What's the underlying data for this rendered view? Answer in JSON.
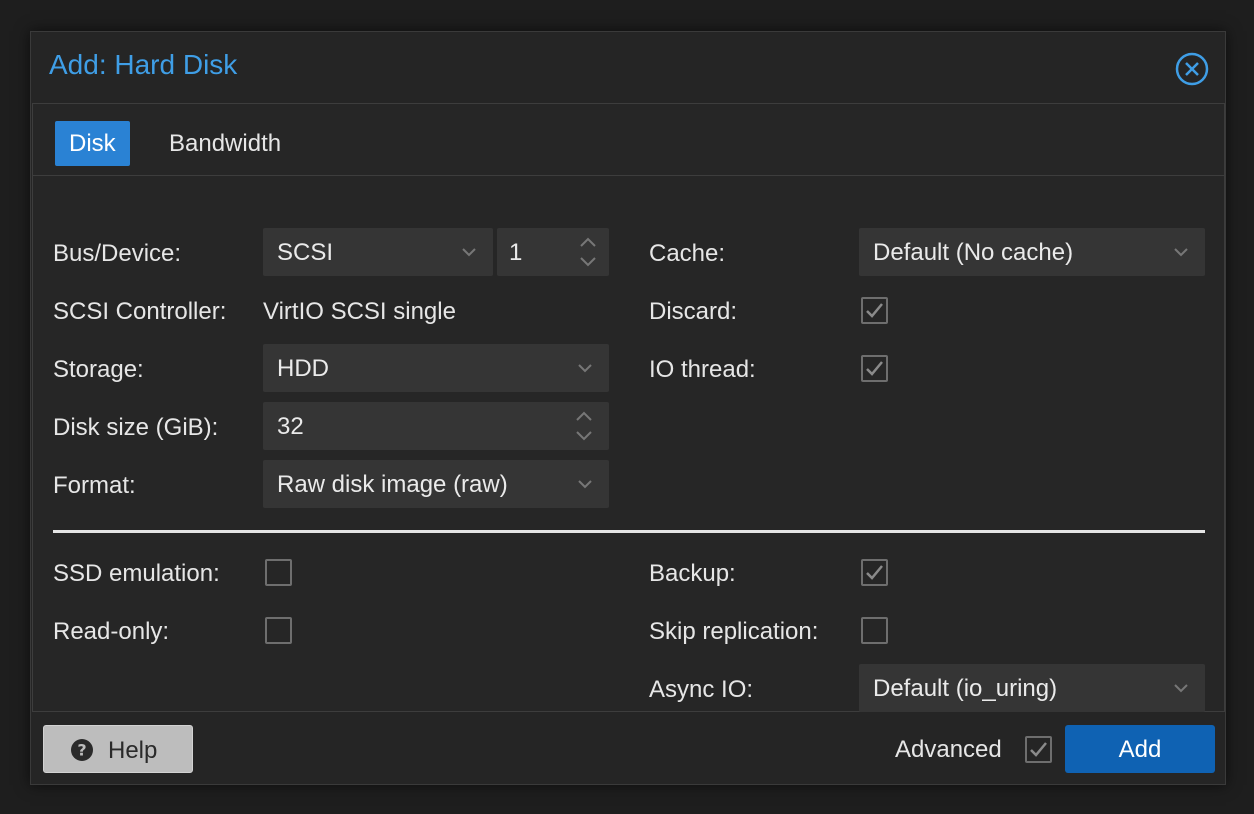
{
  "dialog": {
    "title": "Add: Hard Disk",
    "close_icon": "close-circle-icon"
  },
  "tabs": [
    {
      "label": "Disk",
      "active": true
    },
    {
      "label": "Bandwidth",
      "active": false
    }
  ],
  "left_fields": {
    "bus_device": {
      "label": "Bus/Device:",
      "bus": "SCSI",
      "device": "1"
    },
    "scsi_controller": {
      "label": "SCSI Controller:",
      "value": "VirtIO SCSI single"
    },
    "storage": {
      "label": "Storage:",
      "value": "HDD"
    },
    "disk_size": {
      "label": "Disk size (GiB):",
      "value": "32"
    },
    "format": {
      "label": "Format:",
      "value": "Raw disk image (raw)"
    }
  },
  "right_fields": {
    "cache": {
      "label": "Cache:",
      "value": "Default (No cache)"
    },
    "discard": {
      "label": "Discard:",
      "checked": true
    },
    "io_thread": {
      "label": "IO thread:",
      "checked": true
    }
  },
  "advanced_left": {
    "ssd_emulation": {
      "label": "SSD emulation:",
      "checked": false
    },
    "read_only": {
      "label": "Read-only:",
      "checked": false
    }
  },
  "advanced_right": {
    "backup": {
      "label": "Backup:",
      "checked": true
    },
    "skip_replication": {
      "label": "Skip replication:",
      "checked": false
    },
    "async_io": {
      "label": "Async IO:",
      "value": "Default (io_uring)"
    }
  },
  "footer": {
    "help_label": "Help",
    "help_icon": "question-circle-icon",
    "advanced_label": "Advanced",
    "advanced_checked": true,
    "add_label": "Add"
  },
  "colors": {
    "accent": "#2a82d4",
    "title": "#3f9ee6",
    "add_button": "#0f62b3",
    "background": "#252525",
    "field": "#353535"
  }
}
